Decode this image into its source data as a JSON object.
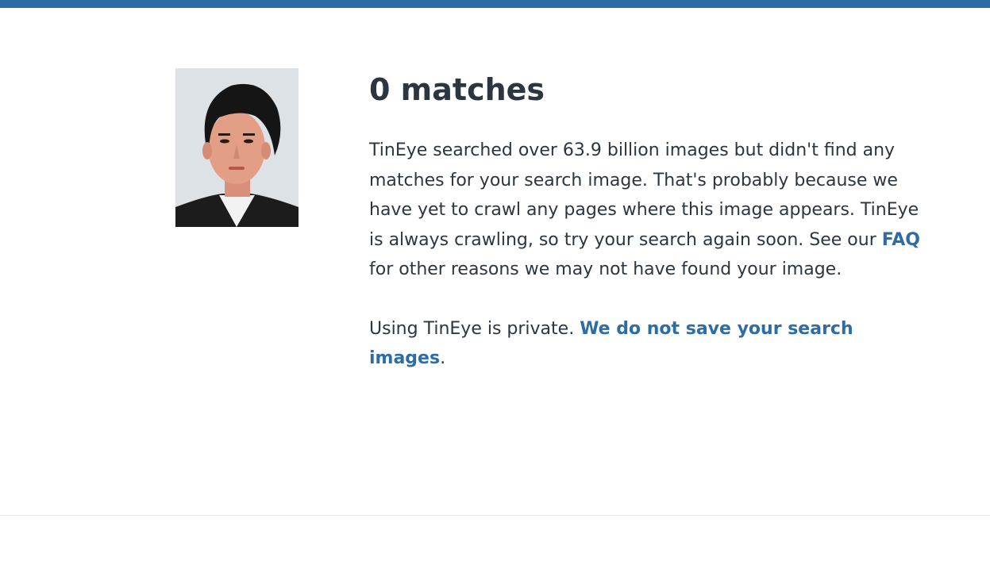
{
  "results": {
    "heading": "0 matches",
    "message_part1": "TinEye searched over 63.9 billion images but didn't find any matches for your search image. That's probably because we have yet to crawl any pages where this image appears. TinEye is always crawling, so try your search again soon. See our ",
    "faq_link": "FAQ",
    "message_part2": " for other reasons we may not have found your image.",
    "privacy_text": "Using TinEye is private. ",
    "privacy_link": "We do not save your search images",
    "privacy_end": "."
  },
  "colors": {
    "accent": "#2e6da4",
    "text": "#2c3640"
  }
}
